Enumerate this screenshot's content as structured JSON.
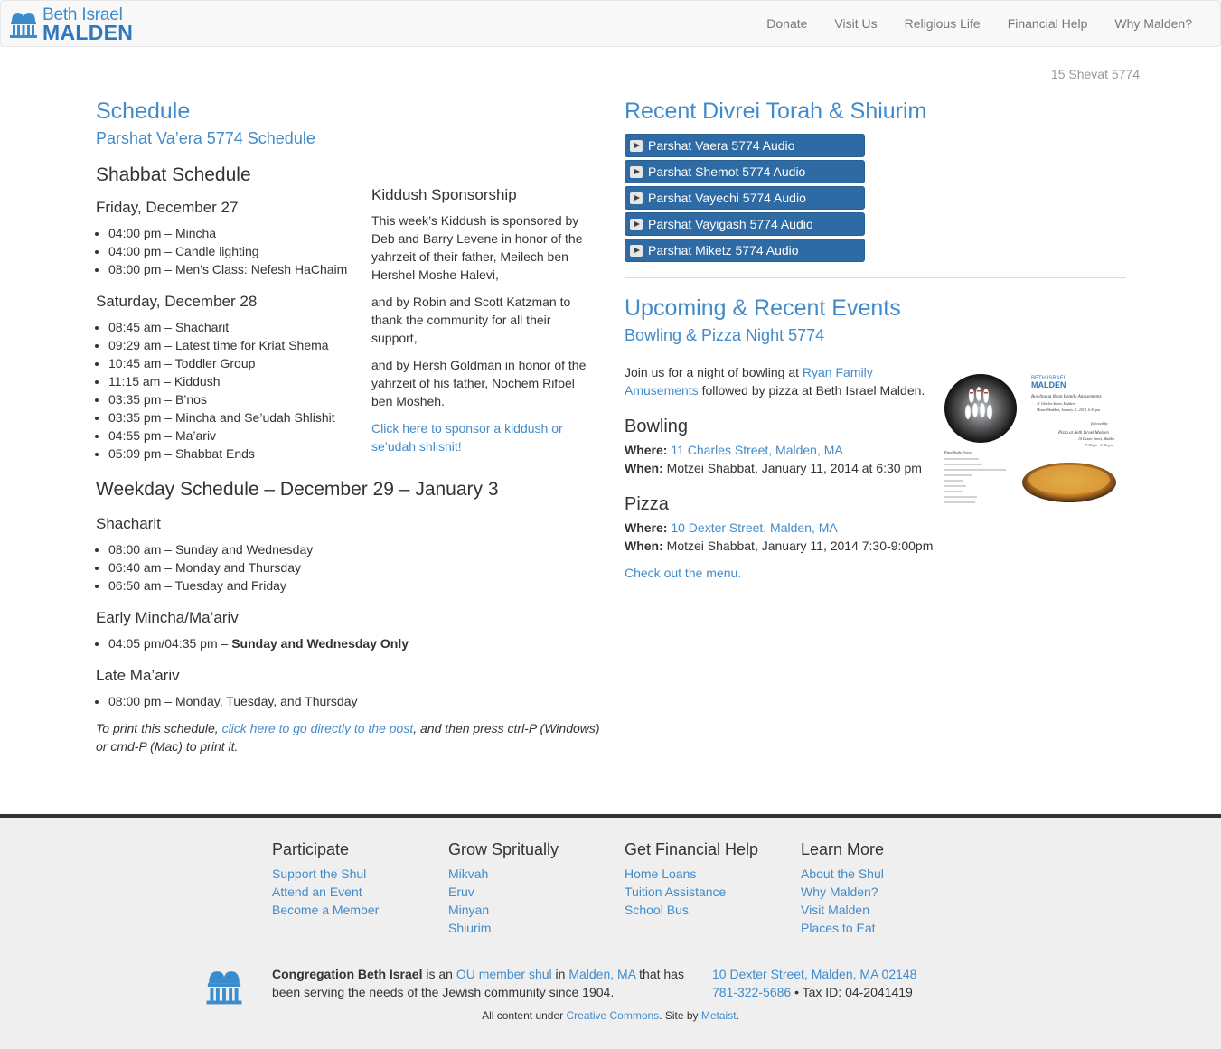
{
  "header": {
    "logo_top": "Beth Israel",
    "logo_bottom": "MALDEN",
    "nav": [
      "Donate",
      "Visit Us",
      "Religious Life",
      "Financial Help",
      "Why Malden?"
    ]
  },
  "hebrew_date": "15 Shevat 5774",
  "schedule": {
    "title": "Schedule",
    "subtitle": "Parshat Va’era 5774 Schedule",
    "shabbat_heading": "Shabbat Schedule",
    "friday_heading": "Friday, December 27",
    "friday_items": [
      "04:00 pm – Mincha",
      "04:00 pm – Candle lighting",
      "08:00 pm – Men’s Class: Nefesh HaChaim"
    ],
    "saturday_heading": "Saturday, December 28",
    "saturday_items": [
      "08:45 am – Shacharit",
      "09:29 am – Latest time for Kriat Shema",
      "10:45 am – Toddler Group",
      "11:15 am – Kiddush",
      "03:35 pm – B’nos",
      "03:35 pm – Mincha and Se’udah Shlishit",
      "04:55 pm – Ma’ariv",
      "05:09 pm – Shabbat Ends"
    ],
    "weekday_heading": "Weekday Schedule – December 29 – January 3",
    "shacharit_heading": "Shacharit",
    "shacharit_items": [
      "08:00 am – Sunday and Wednesday",
      "06:40 am – Monday and Thursday",
      "06:50 am – Tuesday and Friday"
    ],
    "early_heading": "Early Mincha/Ma’ariv",
    "early_item_prefix": "04:05 pm/04:35 pm – ",
    "early_item_bold": "Sunday and Wednesday Only",
    "late_heading": "Late Ma’ariv",
    "late_items": [
      "08:00 pm – Monday, Tuesday, and Thursday"
    ],
    "print_prefix": "To print this schedule, ",
    "print_link": "click here to go directly to the post",
    "print_suffix": ", and then press ctrl-P (Windows) or cmd-P (Mac) to print it."
  },
  "kiddush": {
    "heading": "Kiddush Sponsorship",
    "p1": "This week’s Kiddush is sponsored by Deb and Barry Levene in honor of the yahrzeit of their father, Meilech ben Hershel Moshe Halevi,",
    "p2": "and by Robin and Scott Katzman to thank the community for all their support,",
    "p3": "and by Hersh Goldman in honor of the yahrzeit of his father, Nochem Rifoel ben Mosheh.",
    "link": "Click here to sponsor a kiddush or se’udah shlishit!"
  },
  "torah": {
    "title": "Recent Divrei Torah & Shiurim",
    "audio": [
      "Parshat Vaera 5774 Audio",
      "Parshat Shemot 5774 Audio",
      "Parshat Vayechi 5774 Audio",
      "Parshat Vayigash 5774 Audio",
      "Parshat Miketz 5774 Audio"
    ]
  },
  "events": {
    "title": "Upcoming & Recent Events",
    "subtitle": "Bowling & Pizza Night 5774",
    "intro_prefix": "Join us for a night of bowling at ",
    "intro_link": "Ryan Family Amusements",
    "intro_suffix": " followed by pizza at Beth Israel Malden.",
    "bowling_heading": "Bowling",
    "where_label": "Where:",
    "when_label": "When:",
    "bowling_where": "11 Charles Street, Malden, MA",
    "bowling_when": " Motzei Shabbat, January 11, 2014 at 6:30 pm",
    "pizza_heading": "Pizza",
    "pizza_where": "10 Dexter Street, Malden, MA",
    "pizza_when": " Motzei Shabbat, January 11, 2014 7:30-9:00pm",
    "menu_link": "Check out the menu."
  },
  "flyer": {
    "logo_top": "BETH ISRAEL",
    "logo_bottom": "MALDEN",
    "line1": "Bowling at Ryan Family Amusements",
    "line2": "11 Charles Street, Malden",
    "line3": "Motzei Shabbat, January 11, 2014, 6:30 pm",
    "line4": "followed by",
    "line5": "Pizza at Beth Israel Malden",
    "line6": "10 Dexter Street, Malden",
    "line7": "7:30 pm - 9:00 pm",
    "line8": "Pizza Night Prices"
  },
  "footer": {
    "cols": [
      {
        "title": "Participate",
        "links": [
          "Support the Shul",
          "Attend an Event",
          "Become a Member"
        ]
      },
      {
        "title": "Grow Spritually",
        "links": [
          "Mikvah",
          "Eruv",
          "Minyan",
          "Shiurim"
        ]
      },
      {
        "title": "Get Financial Help",
        "links": [
          "Home Loans",
          "Tuition Assistance",
          "School Bus"
        ]
      },
      {
        "title": "Learn More",
        "links": [
          "About the Shul",
          "Why Malden?",
          "Visit Malden",
          "Places to Eat"
        ]
      }
    ],
    "about_bold": "Congregation Beth Israel",
    "about_1": " is an ",
    "about_link1": "OU member shul",
    "about_2": " in ",
    "about_link2": "Malden, MA",
    "about_3": " that has been serving the needs of the Jewish community since 1904.",
    "address": "10 Dexter Street, Malden, MA 02148",
    "phone": "781-322-5686",
    "tax": " • Tax ID: 04-2041419",
    "credit_1": "All content under ",
    "credit_link1": "Creative Commons",
    "credit_2": ". Site by ",
    "credit_link2": "Metaist",
    "credit_3": "."
  },
  "colors": {
    "link": "#428bca",
    "audio_button": "#2e6aa3",
    "footer_bg": "#efefef"
  }
}
